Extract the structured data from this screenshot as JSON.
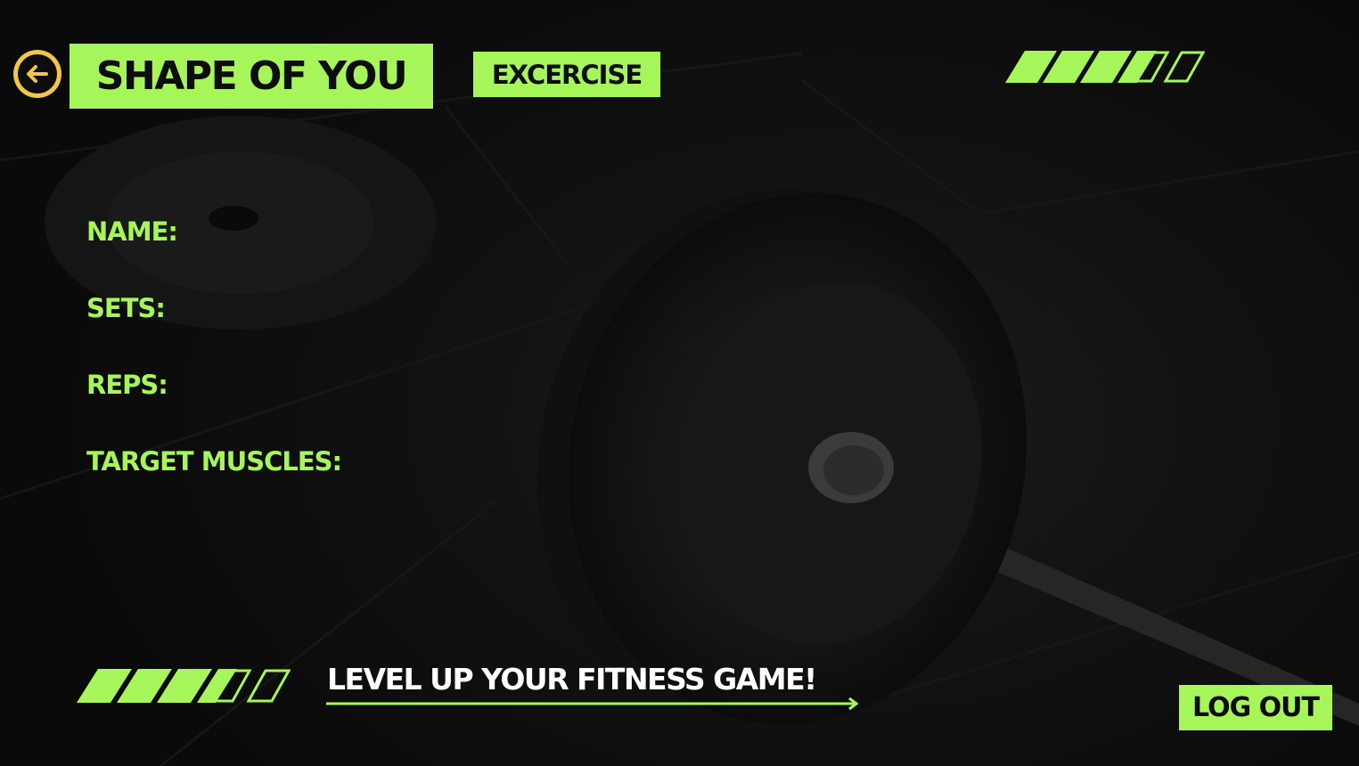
{
  "header": {
    "back_icon": "arrow-left-circle-icon",
    "brand": "SHAPE OF YOU",
    "section": "EXCERCISE"
  },
  "details": {
    "name_label": "NAME:",
    "sets_label": "SETS:",
    "reps_label": "REPS:",
    "target_label": "TARGET MUSCLES:"
  },
  "footer": {
    "tagline": "LEVEL UP YOUR FITNESS GAME!",
    "logout_label": "LOG OUT"
  },
  "progress": {
    "filled": 4,
    "total": 6
  },
  "colors": {
    "accent": "#a6f55a",
    "back_button": "#f2c64a",
    "background": "#0b0b0b",
    "text_dark": "#0d0d0d",
    "text_light": "#ffffff"
  }
}
